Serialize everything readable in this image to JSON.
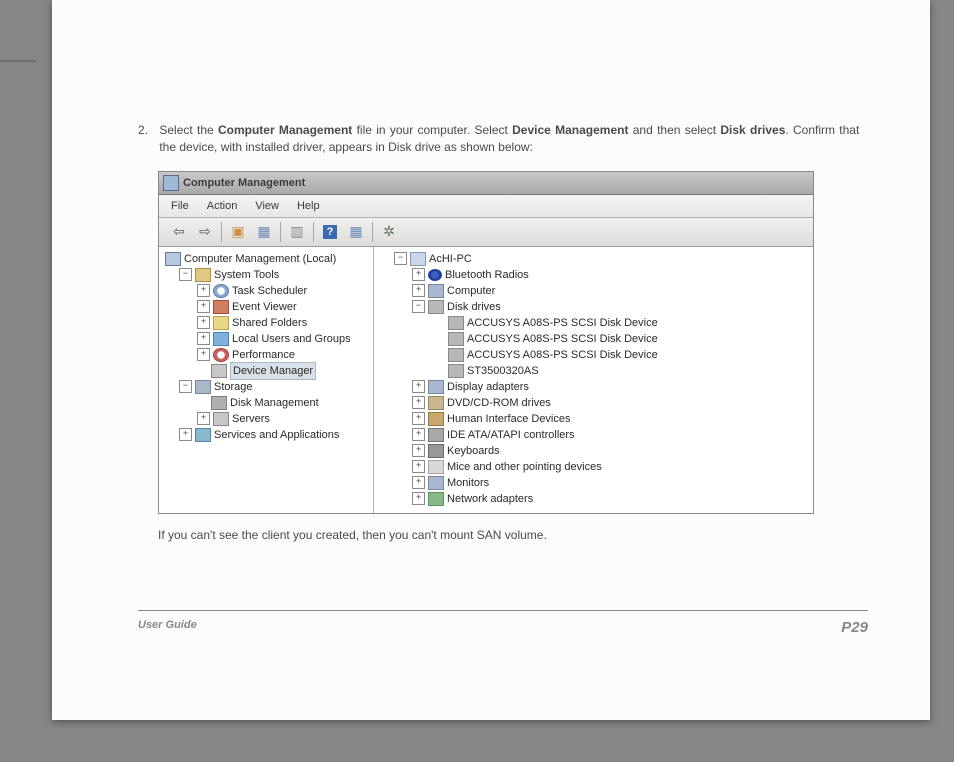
{
  "instruction": {
    "number": "2.",
    "pre": "Select the ",
    "b1": "Computer Management",
    "mid1": " file in your computer. Select ",
    "b2": "Device Management",
    "mid2": " and then select ",
    "b3": "Disk drives",
    "post": ". Confirm that the device, with installed driver, appears in Disk drive as shown below:"
  },
  "window": {
    "title": "Computer Management",
    "menu": {
      "file": "File",
      "action": "Action",
      "view": "View",
      "help": "Help"
    }
  },
  "left_tree": {
    "root": "Computer Management (Local)",
    "sys": "System Tools",
    "task": "Task Scheduler",
    "evt": "Event Viewer",
    "shared": "Shared Folders",
    "users": "Local Users and Groups",
    "perf": "Performance",
    "dev": "Device Manager",
    "storage": "Storage",
    "diskmgmt": "Disk Management",
    "servers": "Servers",
    "svc": "Services and Applications"
  },
  "right_tree": {
    "root": "AcHI-PC",
    "bt": "Bluetooth Radios",
    "comp": "Computer",
    "disk": "Disk drives",
    "d1": "ACCUSYS A08S-PS SCSI Disk Device",
    "d2": "ACCUSYS A08S-PS SCSI Disk Device",
    "d3": "ACCUSYS A08S-PS SCSI Disk Device",
    "d4": "ST3500320AS",
    "disp": "Display adapters",
    "dvd": "DVD/CD-ROM drives",
    "hid": "Human Interface Devices",
    "ide": "IDE ATA/ATAPI controllers",
    "kbd": "Keyboards",
    "mouse": "Mice and other pointing devices",
    "mon": "Monitors",
    "net": "Network adapters"
  },
  "note": "If you can't see the client you created, then you can't mount SAN volume.",
  "footer": {
    "guide": "User Guide",
    "page": "P29"
  }
}
